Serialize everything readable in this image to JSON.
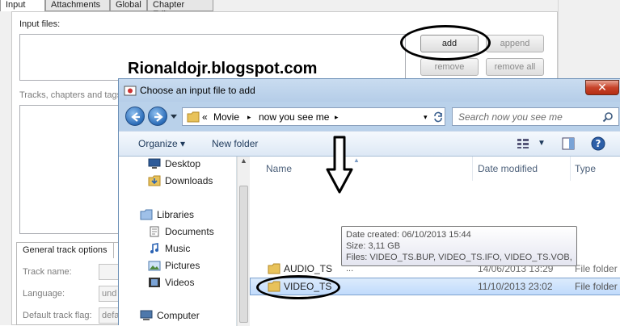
{
  "bg": {
    "tabs": [
      "Input",
      "Attachments",
      "Global",
      "Chapter Editor"
    ],
    "input_files_label": "Input files:",
    "tracks_label": "Tracks, chapters and tags:",
    "buttons": {
      "add": "add",
      "append": "append",
      "remove": "remove",
      "remove_all": "remove all"
    },
    "watermark": "Rionaldojr.blogspot.com",
    "general_tab": "General track options",
    "fields": [
      {
        "label": "Track name:",
        "value": ""
      },
      {
        "label": "Language:",
        "value": "und"
      },
      {
        "label": "Default track flag:",
        "value": "defa"
      }
    ]
  },
  "dialog": {
    "title": "Choose an input file to add",
    "close": "✕",
    "breadcrumb": {
      "prefix": "«",
      "items": [
        "Movie",
        "now you see me"
      ]
    },
    "search_placeholder": "Search now you see me",
    "toolbar": {
      "organize": "Organize",
      "new_folder": "New folder"
    },
    "nav": {
      "favorites": [
        "Desktop",
        "Downloads"
      ],
      "libraries_label": "Libraries",
      "libraries": [
        "Documents",
        "Music",
        "Pictures",
        "Videos"
      ],
      "computer_label": "Computer"
    },
    "columns": {
      "name": "Name",
      "date": "Date modified",
      "type": "Type"
    },
    "files": [
      {
        "name": "AUDIO_TS",
        "date": "14/06/2013 13:29",
        "type": "File folder"
      },
      {
        "name": "VIDEO_TS",
        "date": "11/10/2013 23:02",
        "type": "File folder"
      }
    ],
    "tooltip": {
      "created": "Date created: 06/10/2013 15:44",
      "size": "Size: 3,11 GB",
      "files": "Files: VIDEO_TS.BUP, VIDEO_TS.IFO, VIDEO_TS.VOB, ..."
    }
  },
  "colors": {
    "dialog_frame": "#b9d1ea",
    "selection": "#c1dbfc",
    "close_red": "#c7432a"
  }
}
